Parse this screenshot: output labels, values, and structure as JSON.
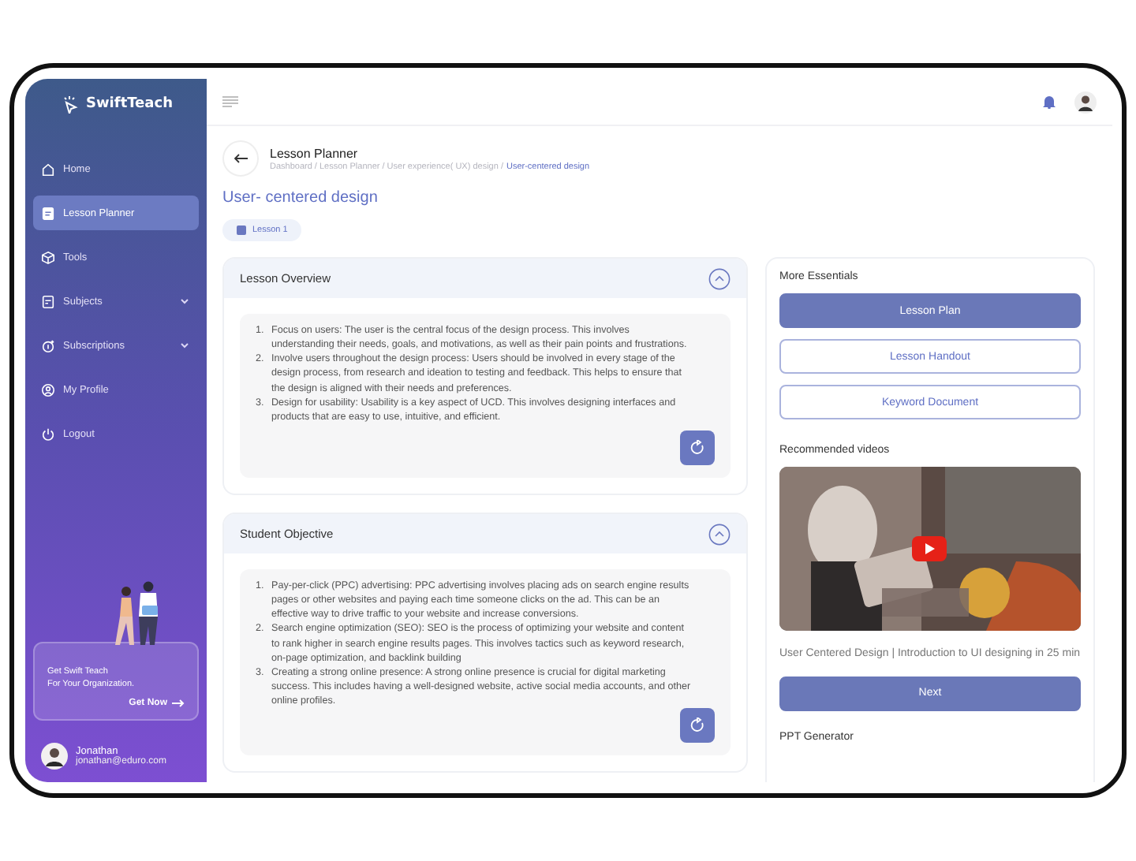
{
  "sidebar": {
    "logo": "SwiftTeach",
    "items": [
      {
        "label": "Home",
        "kind": "home",
        "selected": false,
        "expandable": false
      },
      {
        "label": "Lesson Planner",
        "kind": "file",
        "selected": true,
        "expandable": false
      },
      {
        "label": "Tools",
        "kind": "box",
        "selected": false,
        "expandable": false
      },
      {
        "label": "Subjects",
        "kind": "book",
        "selected": false,
        "expandable": true
      },
      {
        "label": "Subscriptions",
        "kind": "coin",
        "selected": false,
        "expandable": true
      },
      {
        "label": "My Profile",
        "kind": "user",
        "selected": false,
        "expandable": false
      },
      {
        "label": "Logout",
        "kind": "power",
        "selected": false,
        "expandable": false
      }
    ],
    "promo": {
      "line1": "Get Swift Teach",
      "line2": "For Your Organization.",
      "action": "Get Now"
    },
    "user": {
      "name": "Jonathan",
      "email": "jonathan@eduro.com"
    }
  },
  "page": {
    "title": "Lesson Planner",
    "breadcrumb": "Dashboard / Lesson Planner / User experience( UX) design /",
    "current": "User-centered design",
    "heading": "User- centered design",
    "chip": "Lesson 1"
  },
  "sections": [
    {
      "title": "Lesson Overview",
      "expanded": true,
      "items": [
        {
          "number": "1.",
          "text": "Focus on users: The user is the central focus of the design process. This involves understanding their needs, goals, and motivations, as well as their pain points and frustrations."
        },
        {
          "number": "2.",
          "text": "Involve users throughout the design process: Users should be involved in every stage of the design process, from research and ideation to testing and feedback. This helps to ensure that the design is aligned with their needs and preferences."
        },
        {
          "number": "3.",
          "text": "Design for usability: Usability is a key aspect of UCD. This involves designing interfaces and products that are easy to use, intuitive, and efficient."
        }
      ]
    },
    {
      "title": "Student Objective",
      "expanded": true,
      "items": [
        {
          "number": "1.",
          "text": "Pay-per-click (PPC) advertising: PPC advertising involves placing ads on search engine results pages or other websites and paying each time someone clicks on the ad. This can be an effective way to drive traffic to your website and increase conversions."
        },
        {
          "number": "2.",
          "text": "Search engine optimization (SEO): SEO is the process of optimizing your website and content to rank higher in search engine results pages. This involves tactics such as keyword research, on-page optimization, and backlink building"
        },
        {
          "number": "3.",
          "text": "Creating a strong online presence: A strong online presence is crucial for digital marketing success. This includes having a well-designed website, active social media accounts, and other online profiles."
        }
      ]
    }
  ],
  "essentials": {
    "title": "More Essentials",
    "buttons": [
      {
        "label": "Lesson Plan",
        "selected": true
      },
      {
        "label": "Lesson Handout",
        "selected": false
      },
      {
        "label": "Keyword Document",
        "selected": false
      }
    ]
  },
  "videos": {
    "title": "Recommended videos",
    "caption": "User Centered Design | Introduction to UI designing in 25 min",
    "next": "Next"
  },
  "ppt": {
    "title": "PPT Generator"
  }
}
